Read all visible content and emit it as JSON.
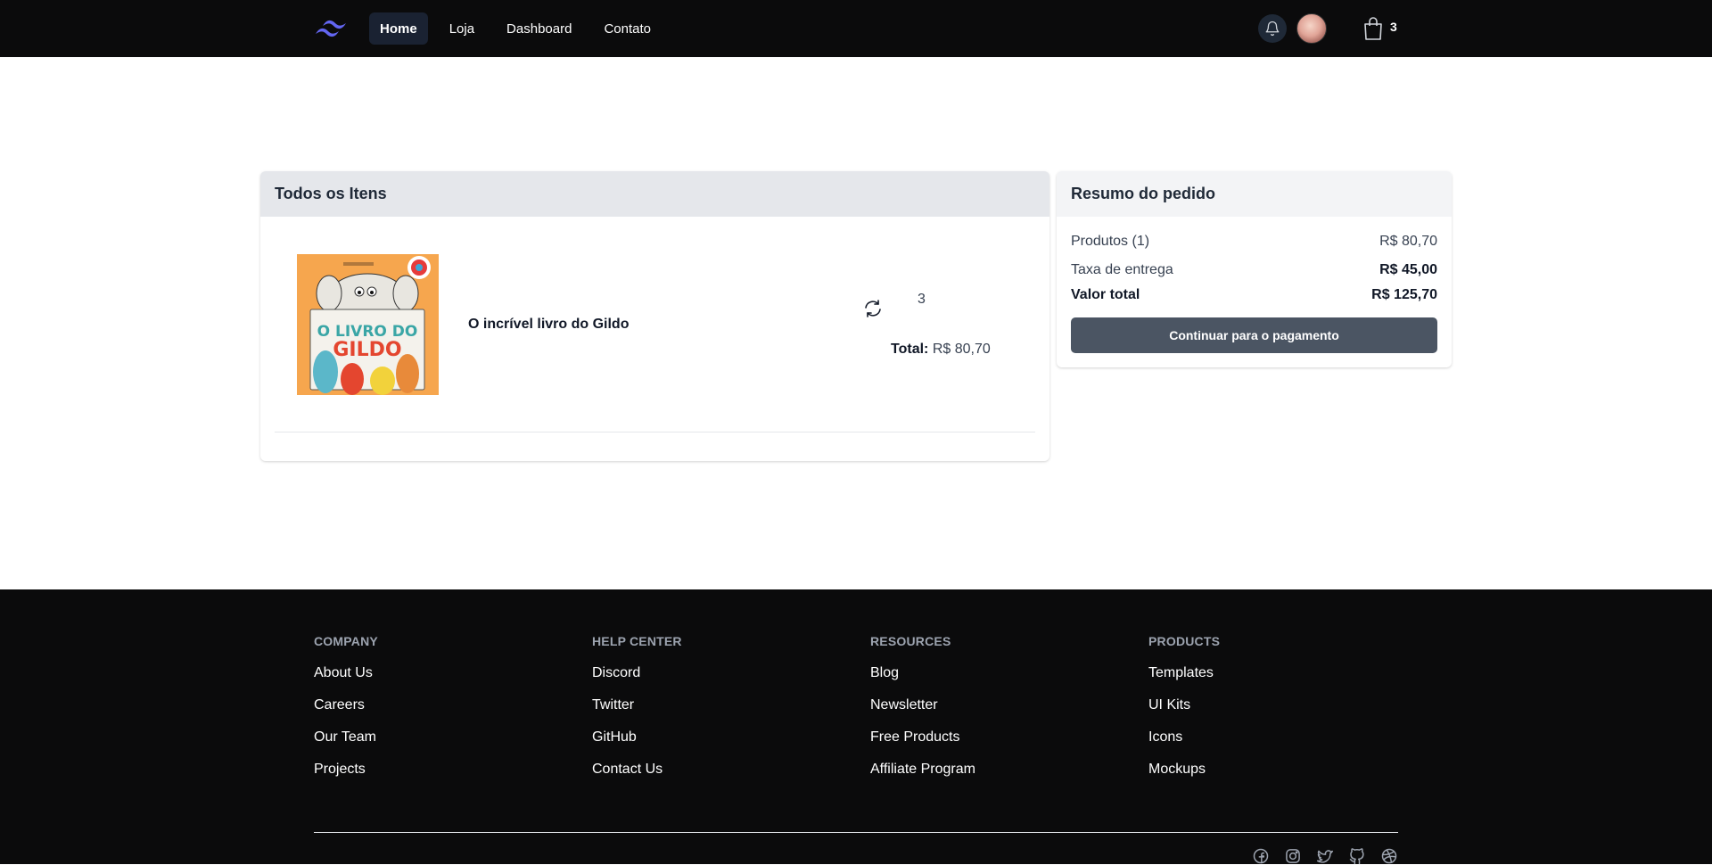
{
  "nav": {
    "links": [
      {
        "label": "Home",
        "active": true
      },
      {
        "label": "Loja"
      },
      {
        "label": "Dashboard"
      },
      {
        "label": "Contato"
      }
    ],
    "cart_count": "3"
  },
  "items": {
    "title": "Todos os Itens",
    "product": {
      "name": "O incrível livro do Gildo",
      "quantity": "3",
      "total_label": "Total:",
      "total_value": "R$ 80,70"
    }
  },
  "summary": {
    "title": "Resumo do pedido",
    "products_label": "Produtos (1)",
    "products_value": "R$ 80,70",
    "delivery_label": "Taxa de entrega",
    "delivery_value": "R$ 45,00",
    "total_label": "Valor total",
    "total_value": "R$ 125,70",
    "checkout_label": "Continuar para o pagamento"
  },
  "footer": {
    "columns": [
      {
        "title": "Company",
        "links": [
          "About Us",
          "Careers",
          "Our Team",
          "Projects"
        ]
      },
      {
        "title": "Help Center",
        "links": [
          "Discord",
          "Twitter",
          "GitHub",
          "Contact Us"
        ]
      },
      {
        "title": "Resources",
        "links": [
          "Blog",
          "Newsletter",
          "Free Products",
          "Affiliate Program"
        ]
      },
      {
        "title": "Products",
        "links": [
          "Templates",
          "UI Kits",
          "Icons",
          "Mockups"
        ]
      }
    ],
    "socials": [
      "facebook-icon",
      "instagram-icon",
      "twitter-icon",
      "github-icon",
      "dribbble-icon"
    ]
  },
  "colors": {
    "nav_bg": "#0b0b0c",
    "logo": "#6366f1",
    "button": "#4b5563"
  }
}
